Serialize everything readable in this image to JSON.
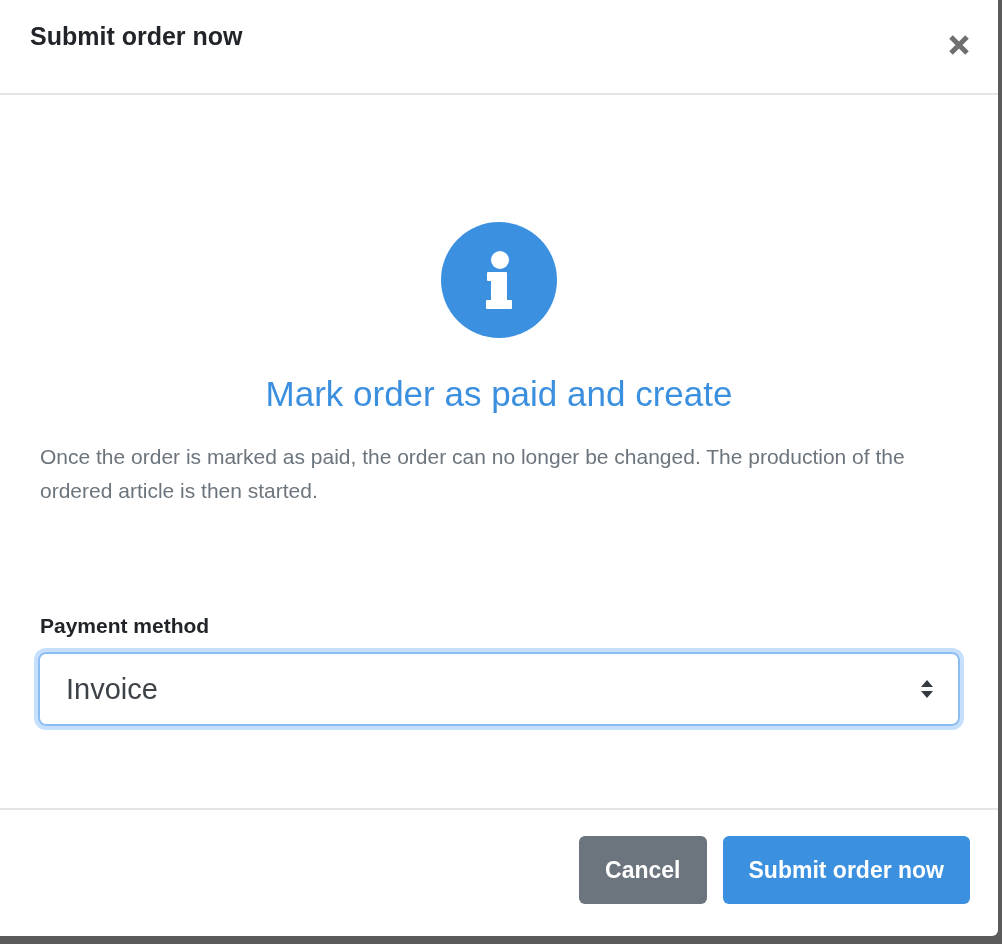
{
  "dialog": {
    "title": "Submit order now"
  },
  "alert": {
    "kind": "info",
    "heading": "Mark order as paid and create",
    "message": "Once the order is marked as paid, the order can no longer be changed. The production of the ordered article is then started."
  },
  "payment_method": {
    "label": "Payment method",
    "value": "Invoice",
    "focused": true
  },
  "buttons": [
    {
      "label": "Cancel",
      "kind": "secondary"
    },
    {
      "label": "Submit order now",
      "kind": "primary"
    }
  ]
}
